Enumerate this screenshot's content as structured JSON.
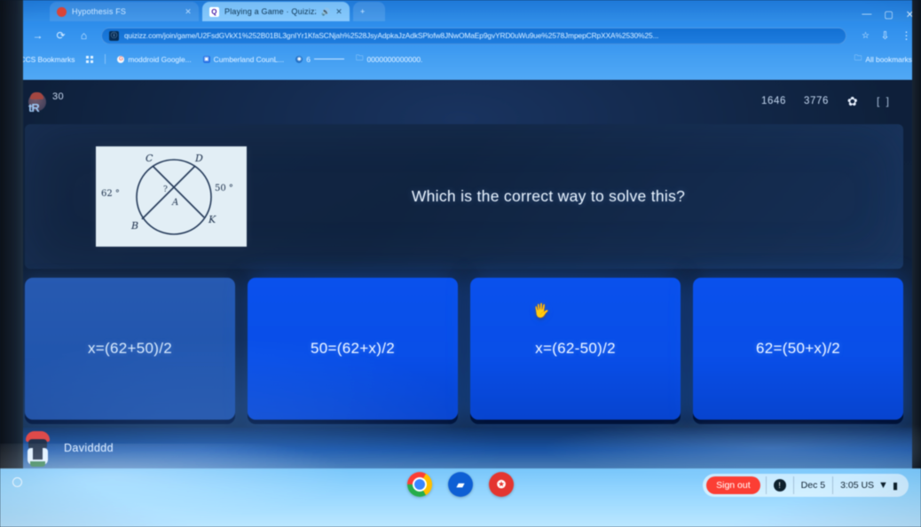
{
  "browser": {
    "tabs": [
      {
        "title": "Hypothesis FS",
        "favicon": "generic-red-icon",
        "active": false
      },
      {
        "title": "Playing a Game · Quizizz",
        "favicon": "quizizz-icon",
        "active": true,
        "audio": true
      }
    ],
    "new_tab_label": "+",
    "window_controls": {
      "minimize": "—",
      "maximize": "▢",
      "close": "✕"
    },
    "nav": {
      "back": "←",
      "forward": "→",
      "reload": "⟳",
      "home": "⌂",
      "url": "quizizz.com/join/game/U2FsdGVkX1%252B01BL3gnIYr1KfaSCNjah%2528JsyAdpkaJzAdkSPlofw8JNwOMaEp9gvYRD0uWu9ue%2578JmpepCRpXXA%2530%25...",
      "site_icon": "page-info-icon",
      "star": "☆",
      "install": "⇩",
      "menu": "⋮"
    },
    "bookmarks": [
      {
        "label": "CCS Bookmarks",
        "icon": "folder-icon"
      },
      {
        "label": "",
        "icon": "apps-grid-icon"
      },
      {
        "label": "moddroid  Google...",
        "icon": "google-icon"
      },
      {
        "label": "Cumberland CounL...",
        "icon": "blue-square-icon"
      },
      {
        "label": "6",
        "icon": "globe-icon"
      },
      {
        "label": "0000000000000.",
        "icon": "folder-icon"
      }
    ],
    "all_bookmarks": "All bookmarks"
  },
  "game": {
    "streak_count": "30",
    "avatar_badge": "tR",
    "score": "1646",
    "total_points": "3776",
    "settings_icon": "gear-icon",
    "fullscreen_icon": "fullscreen-icon",
    "question": {
      "prompt": "Which is the correct way to solve this?",
      "diagram": {
        "name": "circle-with-two-intersecting-chords",
        "center_label": "A",
        "points": [
          "C",
          "D",
          "B",
          "K"
        ],
        "arc_left": "62 °",
        "arc_right": "50 °",
        "unknown": "?"
      },
      "answers": [
        {
          "label": "x=(62+50)/2",
          "state": "hover"
        },
        {
          "label": "50=(62+x)/2",
          "state": "normal"
        },
        {
          "label": "x=(62-50)/2",
          "state": "normal",
          "cursor": "pointing-hand-cursor"
        },
        {
          "label": "62=(50+x)/2",
          "state": "normal"
        }
      ]
    },
    "player": {
      "name": "Davidddd",
      "avatar": "player-avatar"
    }
  },
  "shelf": {
    "launcher": "launcher-icon",
    "apps": [
      {
        "name": "chrome-icon",
        "glyph": ""
      },
      {
        "name": "blue-app-icon",
        "glyph": "▰"
      },
      {
        "name": "red-app-icon",
        "glyph": "✪"
      }
    ],
    "tray": {
      "sign_out": "Sign out",
      "info_icon": "info-icon",
      "date": "Dec 5",
      "time": "3:05 US",
      "wifi_icon": "▼",
      "battery_icon": "▮"
    }
  },
  "colors": {
    "browser_blue": "#3e90df",
    "answer_blue": "#1450d4",
    "answer_hover": "#2a57a3",
    "page_dark": "#16253c",
    "shelf_blue": "#96d0f4",
    "signout_red": "#e8453c"
  }
}
